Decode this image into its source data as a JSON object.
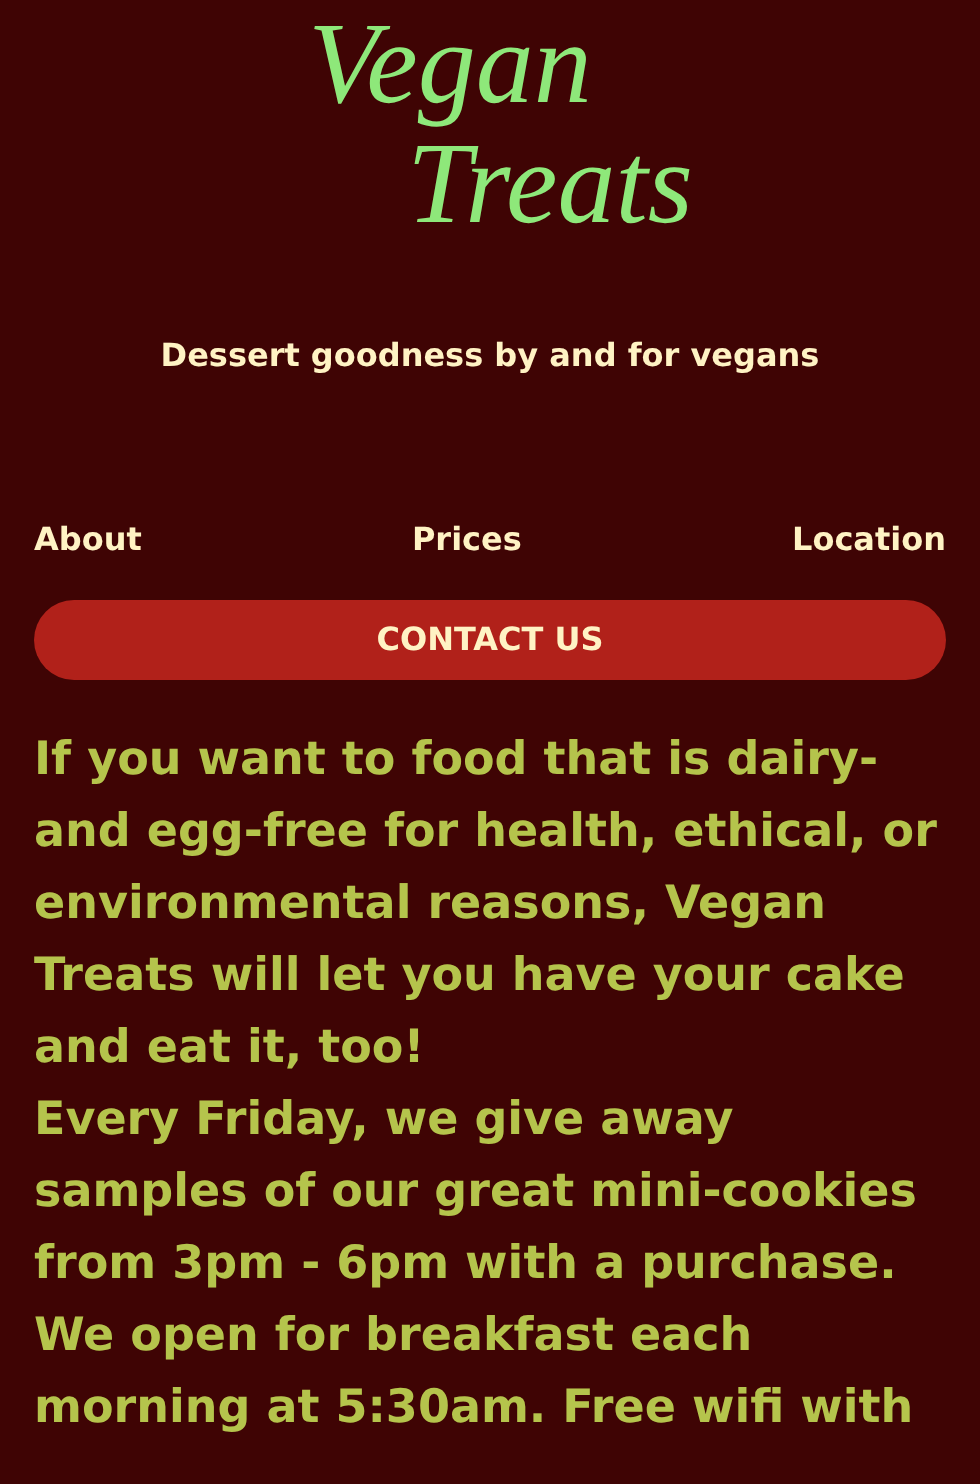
{
  "logo": {
    "lines": [
      "Vegan",
      "Treats"
    ]
  },
  "tagline": "Dessert goodness by and for vegans",
  "nav": [
    "About",
    "Prices",
    "Location"
  ],
  "contact_button": "CONTACT US",
  "paragraphs": [
    "If you want to food that is dairy- and egg-free for health, ethical, or environmental reasons, Vegan Treats will let you have your cake and eat it, too!",
    "Every Friday, we give away samples of our great mini-cookies from 3pm - 6pm with a purchase. We open for breakfast each morning at 5:30am. Free wifi with"
  ]
}
